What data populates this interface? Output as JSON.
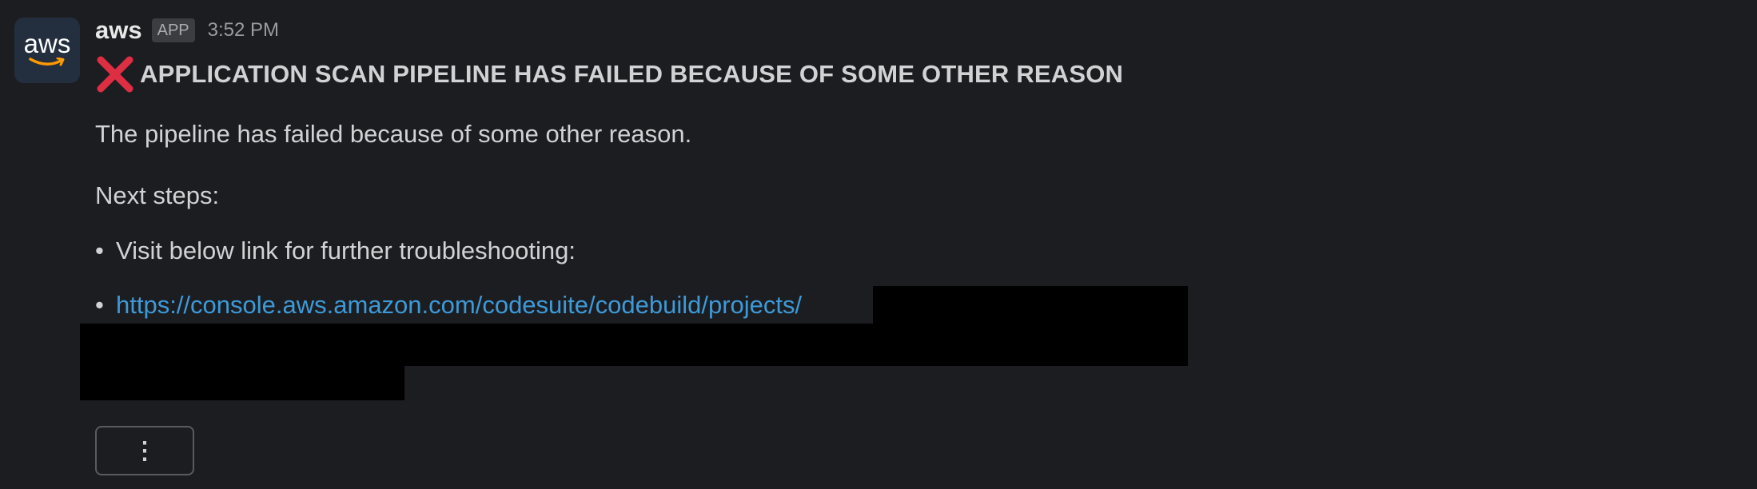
{
  "avatar": {
    "logo_text": "aws"
  },
  "message": {
    "sender": "aws",
    "badge": "APP",
    "time": "3:52 PM",
    "title": "APPLICATION SCAN PIPELINE HAS FAILED BECAUSE OF SOME OTHER REASON",
    "body": "The pipeline has failed because of some other reason.",
    "next_steps_label": "Next steps:",
    "bullets": [
      {
        "marker": "•",
        "text": "Visit below link for further troubleshooting:"
      },
      {
        "marker": "•",
        "link_text": "https://console.aws.amazon.com/codesuite/codebuild/projects/"
      }
    ],
    "more_actions_label": "⋮"
  },
  "colors": {
    "background": "#1c1d21",
    "link": "#3d9ad8",
    "error_icon": "#dd2e44",
    "avatar_bg": "#232f3e",
    "aws_smile": "#ff9900"
  }
}
